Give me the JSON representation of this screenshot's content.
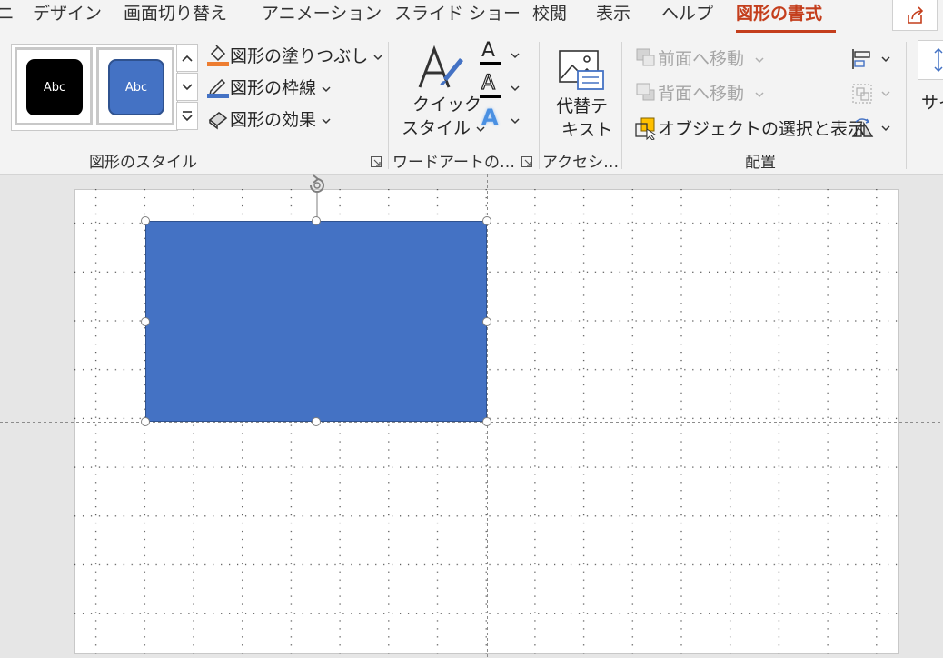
{
  "tabs": [
    {
      "label": "アニ",
      "partial": true
    },
    {
      "label": "デザイン"
    },
    {
      "label": "画面切り替え"
    },
    {
      "label": "アニメーション"
    },
    {
      "label": "スライド ショー"
    },
    {
      "label": "校閲"
    },
    {
      "label": "表示"
    },
    {
      "label": "ヘルプ"
    },
    {
      "label": "図形の書式",
      "active": true
    }
  ],
  "ribbon": {
    "shape_styles": {
      "group_label": "図形のスタイル",
      "gallery": [
        {
          "text": "Abc",
          "fill": "#000000"
        },
        {
          "text": "Abc",
          "fill": "#4472c4"
        }
      ],
      "fill_label": "図形の塗りつぶし",
      "outline_label": "図形の枠線",
      "effects_label": "図形の効果"
    },
    "wordart": {
      "group_label": "ワードアートの…",
      "quick_style_line1": "クイック",
      "quick_style_line2": "スタイル",
      "text_fill_glyph": "A",
      "text_outline_glyph": "A",
      "text_effects_glyph": "A"
    },
    "accessibility": {
      "group_label": "アクセシ…",
      "alt_text_line1": "代替テ",
      "alt_text_line2": "キスト"
    },
    "arrange": {
      "group_label": "配置",
      "bring_forward": "前面へ移動",
      "send_backward": "背面へ移動",
      "selection_pane": "オブジェクトの選択と表示"
    },
    "size": {
      "label_partial": "サイ"
    }
  },
  "colors": {
    "accent": "#c43e1c",
    "shape_fill": "#4472c4",
    "shape_border": "#2f528f"
  }
}
